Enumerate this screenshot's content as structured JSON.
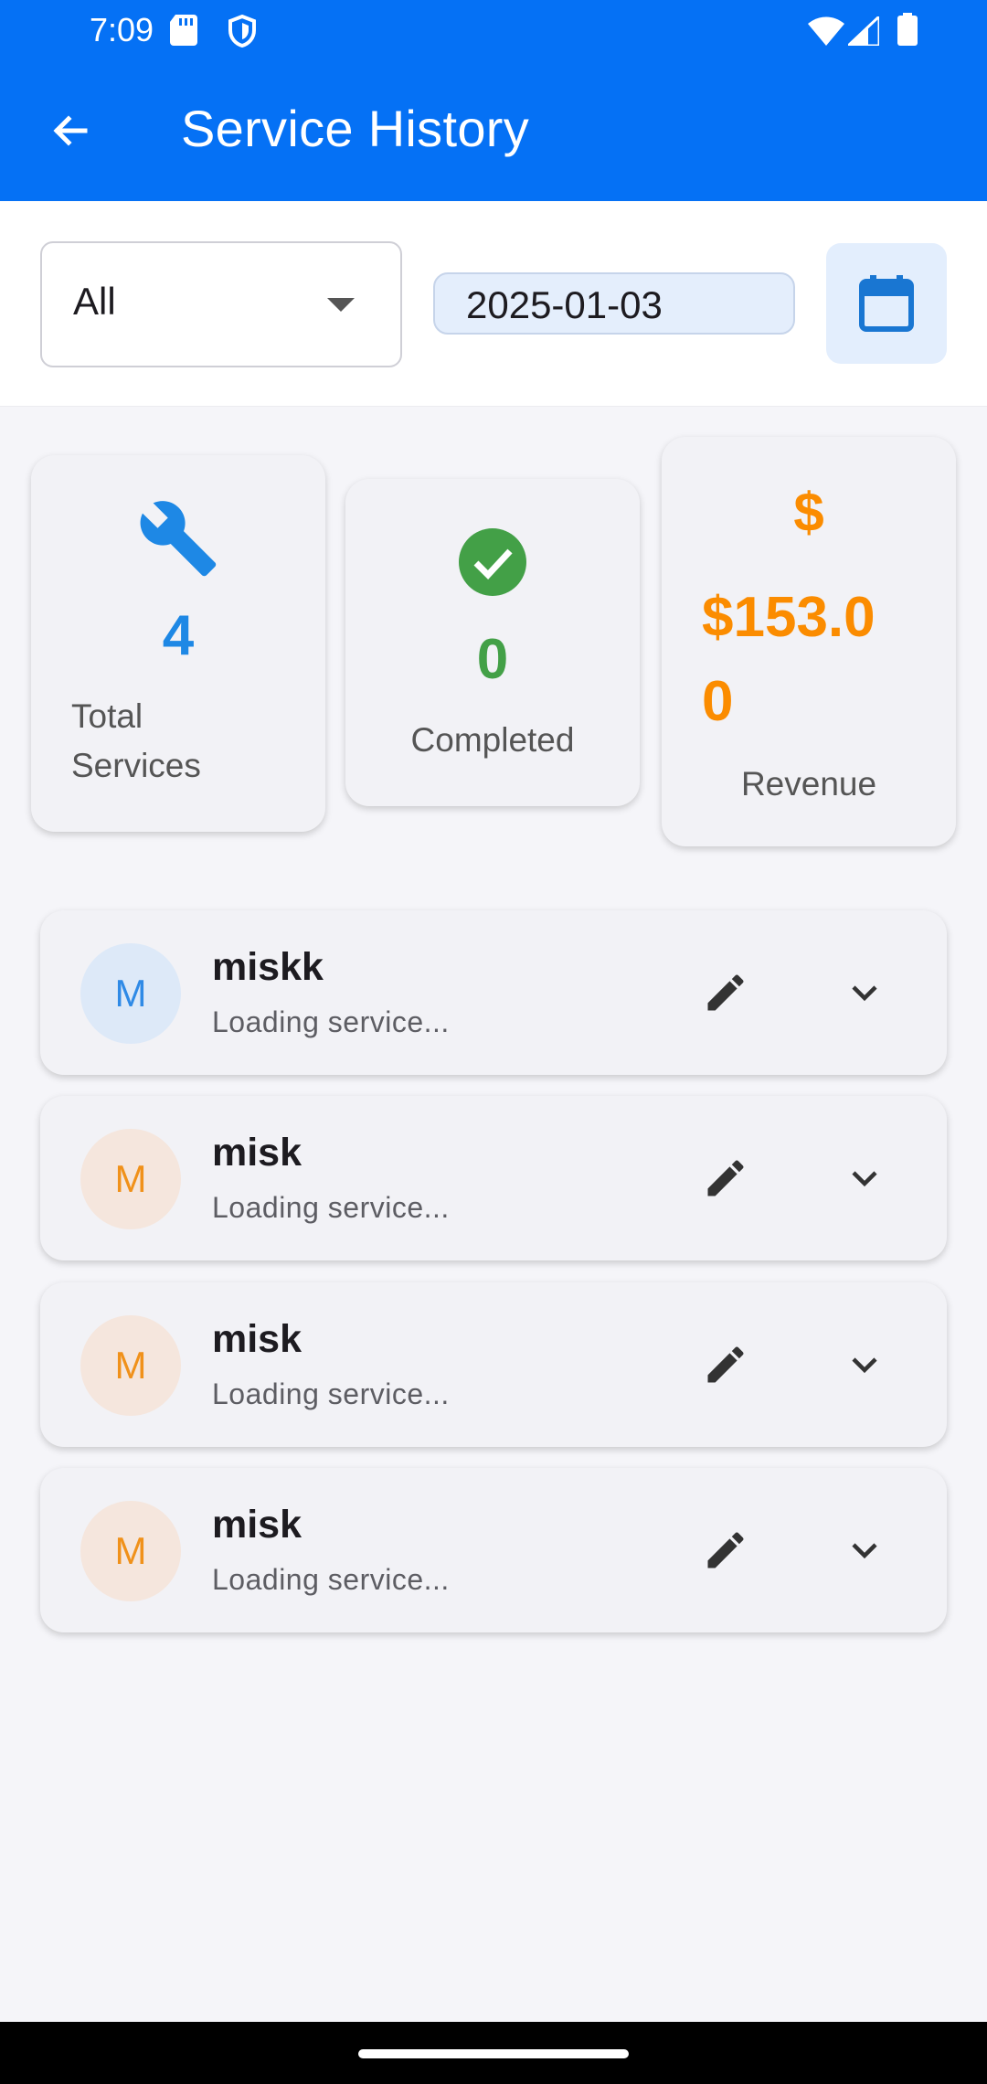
{
  "status_bar": {
    "time": "7:09"
  },
  "app_bar": {
    "title": "Service History"
  },
  "filters": {
    "status_selected": "All",
    "date": "2025-01-03"
  },
  "stats": {
    "total": {
      "value": "4",
      "label_line1": "Total",
      "label_line2": "Services",
      "color": "#1e88e5"
    },
    "completed": {
      "value": "0",
      "label": "Completed",
      "color": "#43a047"
    },
    "revenue": {
      "symbol": "$",
      "value_line1": "$153.0",
      "value_line2": "0",
      "label": "Revenue",
      "color": "#fb8c00"
    }
  },
  "services": [
    {
      "initial": "M",
      "name": "miskk",
      "subtitle": "Loading service...",
      "avatar_bg": "#dde9f8",
      "avatar_fg": "#2f8ae6"
    },
    {
      "initial": "M",
      "name": "misk",
      "subtitle": "Loading service...",
      "avatar_bg": "#f5e6dd",
      "avatar_fg": "#f0911a"
    },
    {
      "initial": "M",
      "name": "misk",
      "subtitle": "Loading service...",
      "avatar_bg": "#f5e6dd",
      "avatar_fg": "#f0911a"
    },
    {
      "initial": "M",
      "name": "misk",
      "subtitle": "Loading service...",
      "avatar_bg": "#f5e6dd",
      "avatar_fg": "#f0911a"
    }
  ],
  "colors": {
    "primary": "#0571f5",
    "background": "#f5f5f9"
  }
}
